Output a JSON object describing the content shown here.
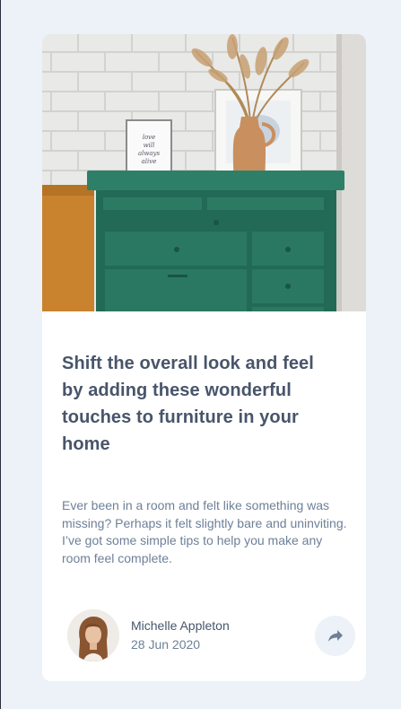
{
  "article": {
    "title": "Shift the overall look and feel by adding these wonderful touches to furniture in your home",
    "description": "Ever been in a room and felt like something was missing? Perhaps it felt slightly bare and uninviting. I’ve got some simple tips to help you make any room feel complete.",
    "hero_frame_text": "love will always alive"
  },
  "author": {
    "name": "Michelle Appleton",
    "date": "28 Jun 2020"
  },
  "icons": {
    "share": "share-icon"
  },
  "colors": {
    "background": "#ecf2f8",
    "title": "#48556a",
    "text": "#6e8098",
    "card": "#ffffff"
  }
}
